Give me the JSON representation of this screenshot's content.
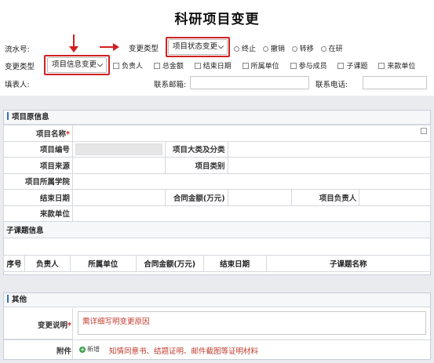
{
  "page_title": "科研项目变更",
  "form": {
    "serial_label": "流水号:",
    "change_kind_label": "变更类型",
    "change_kind_value": "项目状态变更",
    "status_options": [
      "终止",
      "撤销",
      "转移",
      "在研"
    ],
    "change_type_label": "变更类型",
    "change_type_value": "项目信息变更",
    "field_options": [
      "负责人",
      "总金额",
      "结束日期",
      "所属单位",
      "参与成员",
      "子课题",
      "来款单位"
    ],
    "filler_label": "填表人:",
    "email_label": "联系邮箱:",
    "phone_label": "联系电话:"
  },
  "original_section": {
    "title": "项目原信息",
    "project_name_label": "项目名称",
    "project_no_label": "项目编号",
    "category_label": "项目大类及分类",
    "source_label": "项目来源",
    "type_label": "项目类别",
    "college_label": "项目所属学院",
    "end_date_label": "结束日期",
    "contract_amount_label": "合同金额(万元)",
    "leader_label": "项目负责人",
    "funder_label": "来款单位",
    "subtopic_title": "子课题信息",
    "subtopic_columns": [
      "序号",
      "负责人",
      "所属单位",
      "合同金额(万元)",
      "结束日期",
      "子课题名称"
    ]
  },
  "other_section": {
    "title": "其他",
    "reason_label": "变更说明",
    "reason_placeholder": "需详细写明变更原因",
    "attachment_label": "附件",
    "add_label": "新增",
    "attachment_hint": "知情同意书、结题证明、邮件截图等证明材料"
  },
  "colors": {
    "accent_red": "#d02020",
    "section_bar": "#3b6fb5",
    "hint_red": "#c0392b"
  }
}
